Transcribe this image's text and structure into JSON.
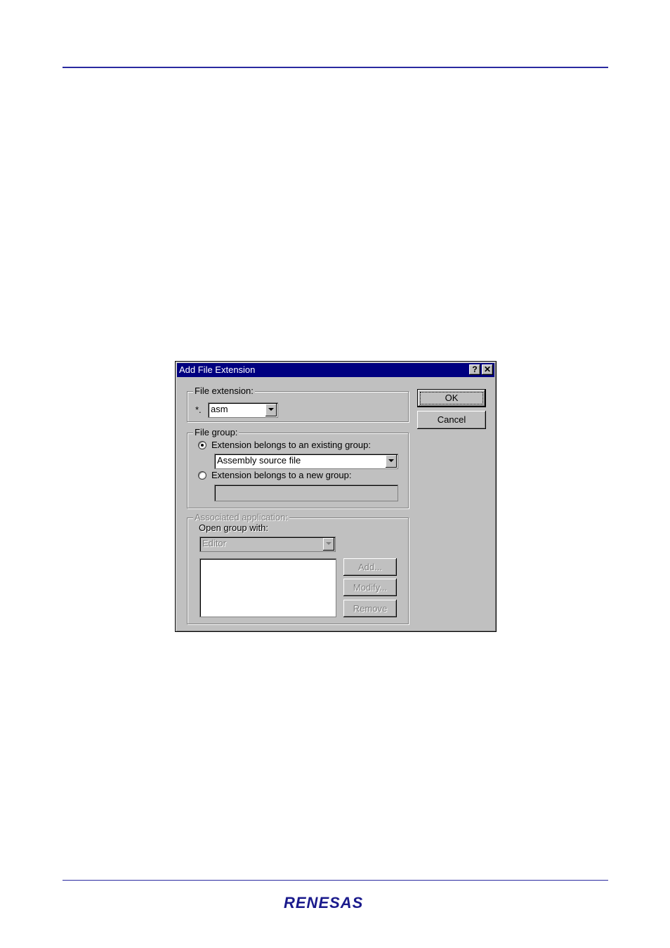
{
  "dialog": {
    "title": "Add File Extension",
    "help_label": "?",
    "close_label": "✕",
    "ok_label": "OK",
    "cancel_label": "Cancel",
    "file_extension": {
      "legend": "File extension:",
      "prefix": "*.",
      "value": "asm"
    },
    "file_group": {
      "legend": "File group:",
      "existing_label": "Extension belongs to an existing group:",
      "existing_value": "Assembly source file",
      "new_label": "Extension belongs to a new group:",
      "new_value": ""
    },
    "associated_application": {
      "legend": "Associated application:",
      "open_with_label": "Open group with:",
      "open_with_value": "Editor",
      "add_label": "Add...",
      "modify_label": "Modify...",
      "remove_label": "Remove"
    }
  },
  "footer": {
    "logo_text": "RENESAS"
  }
}
